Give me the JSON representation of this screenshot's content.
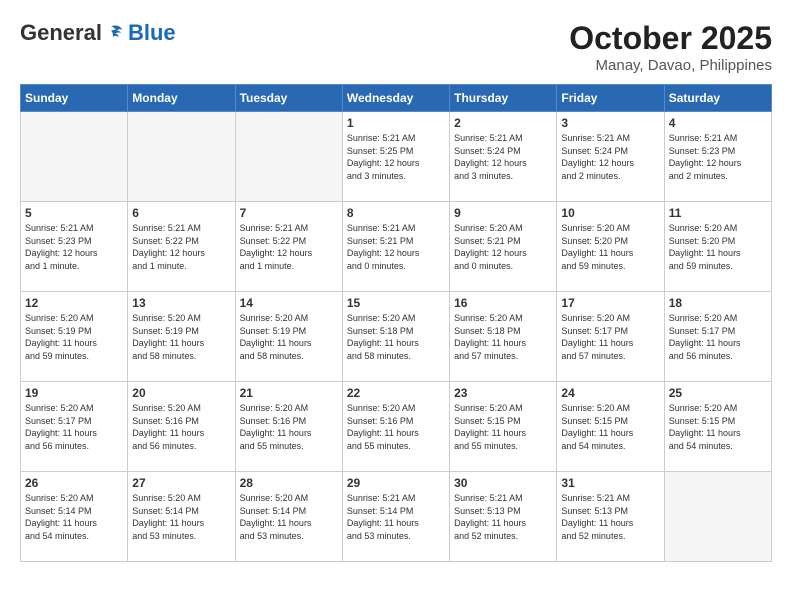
{
  "header": {
    "logo_general": "General",
    "logo_blue": "Blue",
    "month_year": "October 2025",
    "location": "Manay, Davao, Philippines"
  },
  "days_of_week": [
    "Sunday",
    "Monday",
    "Tuesday",
    "Wednesday",
    "Thursday",
    "Friday",
    "Saturday"
  ],
  "weeks": [
    [
      {
        "day": "",
        "content": ""
      },
      {
        "day": "",
        "content": ""
      },
      {
        "day": "",
        "content": ""
      },
      {
        "day": "1",
        "content": "Sunrise: 5:21 AM\nSunset: 5:25 PM\nDaylight: 12 hours\nand 3 minutes."
      },
      {
        "day": "2",
        "content": "Sunrise: 5:21 AM\nSunset: 5:24 PM\nDaylight: 12 hours\nand 3 minutes."
      },
      {
        "day": "3",
        "content": "Sunrise: 5:21 AM\nSunset: 5:24 PM\nDaylight: 12 hours\nand 2 minutes."
      },
      {
        "day": "4",
        "content": "Sunrise: 5:21 AM\nSunset: 5:23 PM\nDaylight: 12 hours\nand 2 minutes."
      }
    ],
    [
      {
        "day": "5",
        "content": "Sunrise: 5:21 AM\nSunset: 5:23 PM\nDaylight: 12 hours\nand 1 minute."
      },
      {
        "day": "6",
        "content": "Sunrise: 5:21 AM\nSunset: 5:22 PM\nDaylight: 12 hours\nand 1 minute."
      },
      {
        "day": "7",
        "content": "Sunrise: 5:21 AM\nSunset: 5:22 PM\nDaylight: 12 hours\nand 1 minute."
      },
      {
        "day": "8",
        "content": "Sunrise: 5:21 AM\nSunset: 5:21 PM\nDaylight: 12 hours\nand 0 minutes."
      },
      {
        "day": "9",
        "content": "Sunrise: 5:20 AM\nSunset: 5:21 PM\nDaylight: 12 hours\nand 0 minutes."
      },
      {
        "day": "10",
        "content": "Sunrise: 5:20 AM\nSunset: 5:20 PM\nDaylight: 11 hours\nand 59 minutes."
      },
      {
        "day": "11",
        "content": "Sunrise: 5:20 AM\nSunset: 5:20 PM\nDaylight: 11 hours\nand 59 minutes."
      }
    ],
    [
      {
        "day": "12",
        "content": "Sunrise: 5:20 AM\nSunset: 5:19 PM\nDaylight: 11 hours\nand 59 minutes."
      },
      {
        "day": "13",
        "content": "Sunrise: 5:20 AM\nSunset: 5:19 PM\nDaylight: 11 hours\nand 58 minutes."
      },
      {
        "day": "14",
        "content": "Sunrise: 5:20 AM\nSunset: 5:19 PM\nDaylight: 11 hours\nand 58 minutes."
      },
      {
        "day": "15",
        "content": "Sunrise: 5:20 AM\nSunset: 5:18 PM\nDaylight: 11 hours\nand 58 minutes."
      },
      {
        "day": "16",
        "content": "Sunrise: 5:20 AM\nSunset: 5:18 PM\nDaylight: 11 hours\nand 57 minutes."
      },
      {
        "day": "17",
        "content": "Sunrise: 5:20 AM\nSunset: 5:17 PM\nDaylight: 11 hours\nand 57 minutes."
      },
      {
        "day": "18",
        "content": "Sunrise: 5:20 AM\nSunset: 5:17 PM\nDaylight: 11 hours\nand 56 minutes."
      }
    ],
    [
      {
        "day": "19",
        "content": "Sunrise: 5:20 AM\nSunset: 5:17 PM\nDaylight: 11 hours\nand 56 minutes."
      },
      {
        "day": "20",
        "content": "Sunrise: 5:20 AM\nSunset: 5:16 PM\nDaylight: 11 hours\nand 56 minutes."
      },
      {
        "day": "21",
        "content": "Sunrise: 5:20 AM\nSunset: 5:16 PM\nDaylight: 11 hours\nand 55 minutes."
      },
      {
        "day": "22",
        "content": "Sunrise: 5:20 AM\nSunset: 5:16 PM\nDaylight: 11 hours\nand 55 minutes."
      },
      {
        "day": "23",
        "content": "Sunrise: 5:20 AM\nSunset: 5:15 PM\nDaylight: 11 hours\nand 55 minutes."
      },
      {
        "day": "24",
        "content": "Sunrise: 5:20 AM\nSunset: 5:15 PM\nDaylight: 11 hours\nand 54 minutes."
      },
      {
        "day": "25",
        "content": "Sunrise: 5:20 AM\nSunset: 5:15 PM\nDaylight: 11 hours\nand 54 minutes."
      }
    ],
    [
      {
        "day": "26",
        "content": "Sunrise: 5:20 AM\nSunset: 5:14 PM\nDaylight: 11 hours\nand 54 minutes."
      },
      {
        "day": "27",
        "content": "Sunrise: 5:20 AM\nSunset: 5:14 PM\nDaylight: 11 hours\nand 53 minutes."
      },
      {
        "day": "28",
        "content": "Sunrise: 5:20 AM\nSunset: 5:14 PM\nDaylight: 11 hours\nand 53 minutes."
      },
      {
        "day": "29",
        "content": "Sunrise: 5:21 AM\nSunset: 5:14 PM\nDaylight: 11 hours\nand 53 minutes."
      },
      {
        "day": "30",
        "content": "Sunrise: 5:21 AM\nSunset: 5:13 PM\nDaylight: 11 hours\nand 52 minutes."
      },
      {
        "day": "31",
        "content": "Sunrise: 5:21 AM\nSunset: 5:13 PM\nDaylight: 11 hours\nand 52 minutes."
      },
      {
        "day": "",
        "content": ""
      }
    ]
  ]
}
